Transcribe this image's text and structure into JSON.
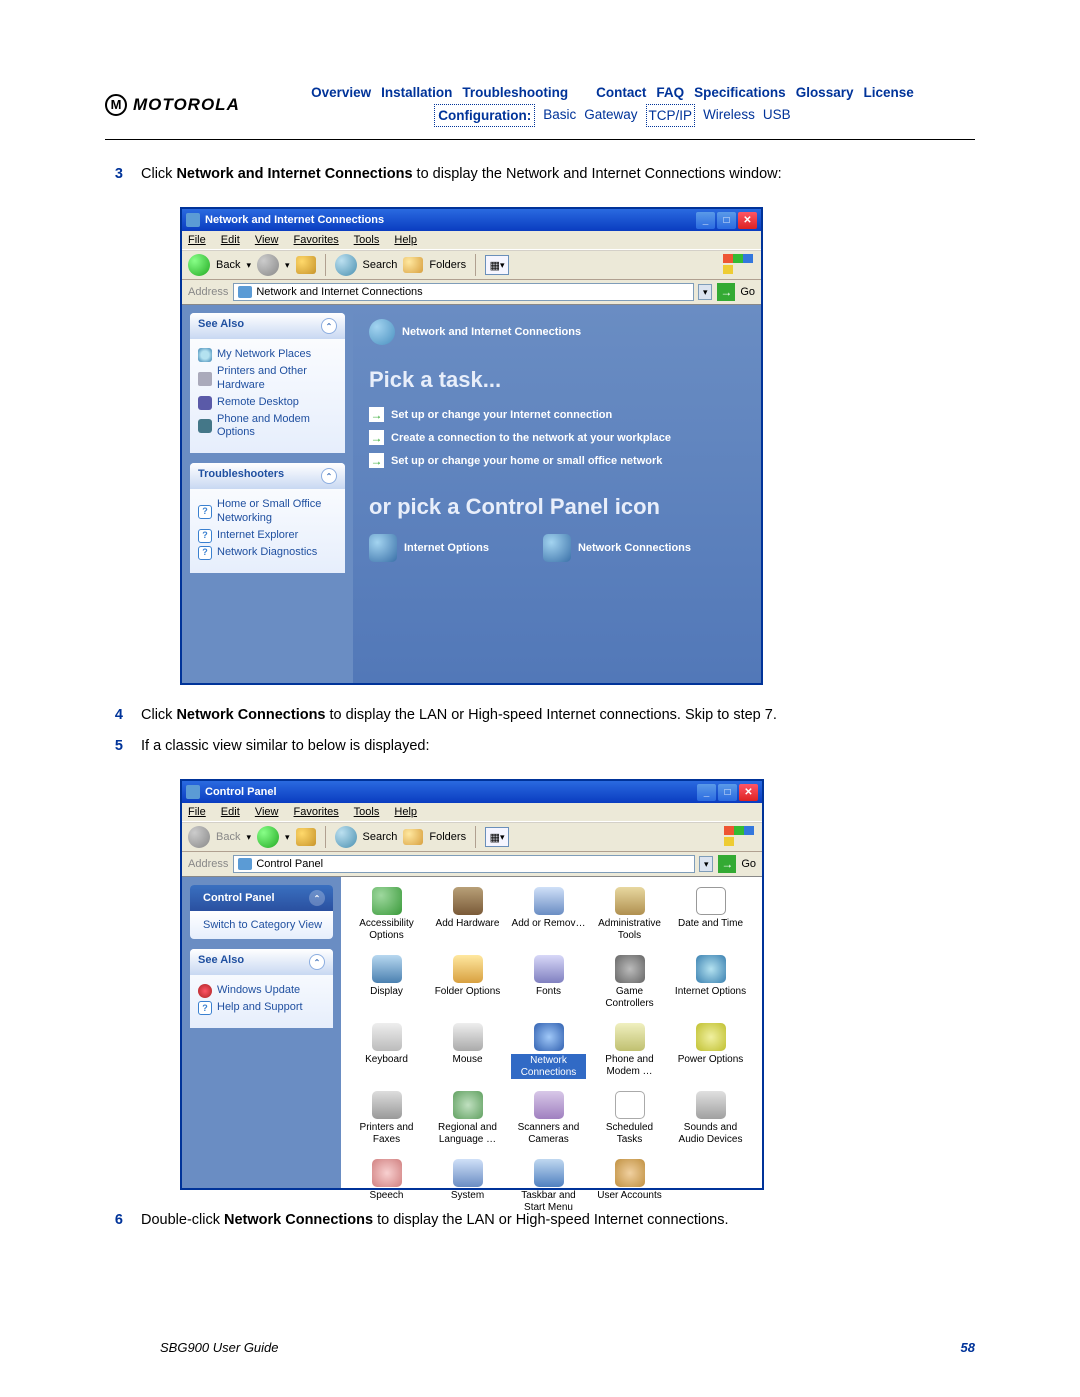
{
  "header": {
    "brand": "MOTOROLA",
    "brand_m": "M",
    "nav": [
      "Overview",
      "Installation",
      "Troubleshooting",
      "Contact",
      "FAQ",
      "Specifications",
      "Glossary",
      "License"
    ],
    "subnav_label": "Configuration:",
    "subnav": [
      "Basic",
      "Gateway",
      "TCP/IP",
      "Wireless",
      "USB"
    ]
  },
  "steps": {
    "s3": {
      "n": "3",
      "pre": "Click ",
      "b": "Network and Internet Connections",
      "post": " to display the Network and Internet Connections window:"
    },
    "s4": {
      "n": "4",
      "pre": "Click ",
      "b": "Network Connections",
      "post": " to display the LAN or High-speed Internet connections. Skip to step 7."
    },
    "s5": {
      "n": "5",
      "text": "If a classic view similar to below is displayed:"
    },
    "s6": {
      "n": "6",
      "pre": "Double-click ",
      "b": "Network Connections",
      "post": " to display the LAN or High-speed Internet connections."
    }
  },
  "shot1": {
    "title": "Network and Internet Connections",
    "menu": [
      "File",
      "Edit",
      "View",
      "Favorites",
      "Tools",
      "Help"
    ],
    "back": "Back",
    "search": "Search",
    "folders": "Folders",
    "addr_label": "Address",
    "addr_text": "Network and Internet Connections",
    "go": "Go",
    "seealso": "See Also",
    "seealso_items": [
      "My Network Places",
      "Printers and Other Hardware",
      "Remote Desktop",
      "Phone and Modem Options"
    ],
    "troubleshooters": "Troubleshooters",
    "ts_items": [
      "Home or Small Office Networking",
      "Internet Explorer",
      "Network Diagnostics"
    ],
    "crumb": "Network and Internet Connections",
    "pick": "Pick a task...",
    "tasks": [
      "Set up or change your Internet connection",
      "Create a connection to the network at your workplace",
      "Set up or change your home or small office network"
    ],
    "orpick": "or pick a Control Panel icon",
    "cp_icons": [
      "Internet Options",
      "Network Connections"
    ]
  },
  "shot2": {
    "title": "Control Panel",
    "menu": [
      "File",
      "Edit",
      "View",
      "Favorites",
      "Tools",
      "Help"
    ],
    "back": "Back",
    "search": "Search",
    "folders": "Folders",
    "addr_label": "Address",
    "addr_text": "Control Panel",
    "go": "Go",
    "cp_title": "Control Panel",
    "switch": "Switch to Category View",
    "seealso": "See Also",
    "seealso_items": [
      "Windows Update",
      "Help and Support"
    ],
    "applets": [
      "Accessibility Options",
      "Add Hardware",
      "Add or Remov…",
      "Administrative Tools",
      "Date and Time",
      "Display",
      "Folder Options",
      "Fonts",
      "Game Controllers",
      "Internet Options",
      "Keyboard",
      "Mouse",
      "Network Connections",
      "Phone and Modem …",
      "Power Options",
      "Printers and Faxes",
      "Regional and Language …",
      "Scanners and Cameras",
      "Scheduled Tasks",
      "Sounds and Audio Devices",
      "Speech",
      "System",
      "Taskbar and Start Menu",
      "User Accounts"
    ]
  },
  "footer": {
    "guide": "SBG900 User Guide",
    "page": "58"
  }
}
